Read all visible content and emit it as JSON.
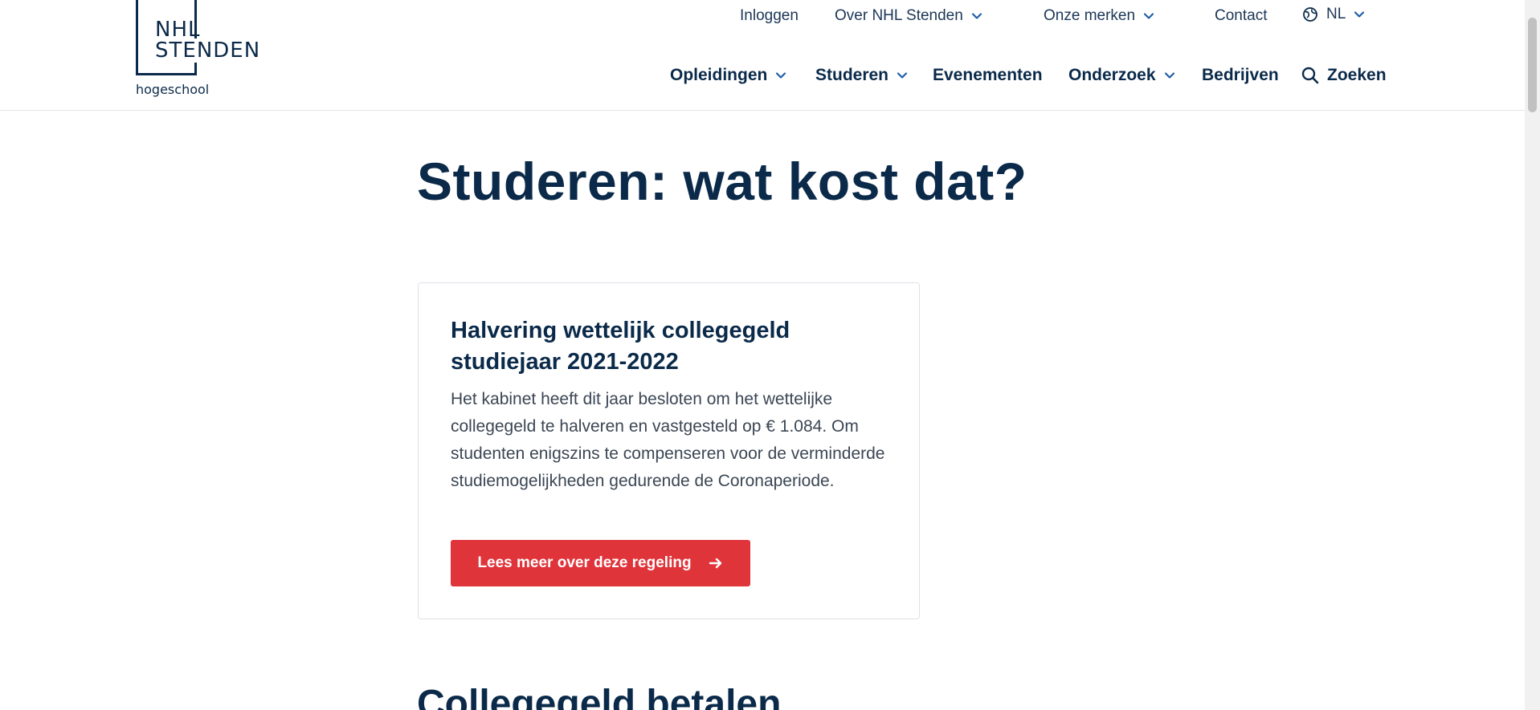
{
  "logo": {
    "line1": "NHL",
    "line2": "STENDEN",
    "subtitle": "hogeschool"
  },
  "top_nav": {
    "login": "Inloggen",
    "about": "Over NHL Stenden",
    "brands": "Onze merken",
    "contact": "Contact",
    "language": "NL"
  },
  "main_nav": {
    "programs": "Opleidingen",
    "studying": "Studeren",
    "events": "Evenementen",
    "research": "Onderzoek",
    "companies": "Bedrijven",
    "search": "Zoeken"
  },
  "page": {
    "title": "Studeren: wat kost dat?"
  },
  "card": {
    "title": "Halvering wettelijk collegegeld studiejaar 2021-2022",
    "text": "Het kabinet heeft dit jaar besloten om het wettelijke collegegeld te halveren en vastgesteld op € 1.084. Om studenten enigszins te compenseren voor de verminderde studiemogelijkheden gedurende de Coronaperiode.",
    "button_label": "Lees meer over deze regeling"
  },
  "section": {
    "title": "Collegegeld betalen"
  },
  "colors": {
    "navy": "#0b2a4a",
    "accent_red": "#e0343b",
    "chevron_blue": "#1f5fa8"
  }
}
